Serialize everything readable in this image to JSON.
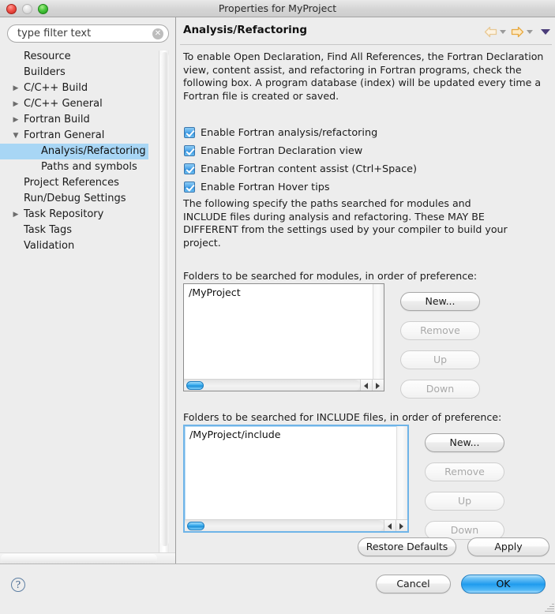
{
  "window": {
    "title": "Properties for MyProject",
    "traffic_lights": [
      "close-button",
      "minimize-button",
      "zoom-button"
    ]
  },
  "sidebar": {
    "filter": {
      "value": "",
      "placeholder": "type filter text",
      "clear_glyph": "✕"
    },
    "items": [
      {
        "label": "Resource",
        "level": 1,
        "twisty": "",
        "selected": false
      },
      {
        "label": "Builders",
        "level": 1,
        "twisty": "",
        "selected": false
      },
      {
        "label": "C/C++ Build",
        "level": 1,
        "twisty": "▶",
        "selected": false
      },
      {
        "label": "C/C++ General",
        "level": 1,
        "twisty": "▶",
        "selected": false
      },
      {
        "label": "Fortran Build",
        "level": 1,
        "twisty": "▶",
        "selected": false
      },
      {
        "label": "Fortran General",
        "level": 1,
        "twisty": "▼",
        "selected": false
      },
      {
        "label": "Analysis/Refactoring",
        "level": 2,
        "twisty": "",
        "selected": true
      },
      {
        "label": "Paths and symbols",
        "level": 2,
        "twisty": "",
        "selected": false
      },
      {
        "label": "Project References",
        "level": 1,
        "twisty": "",
        "selected": false
      },
      {
        "label": "Run/Debug Settings",
        "level": 1,
        "twisty": "",
        "selected": false
      },
      {
        "label": "Task Repository",
        "level": 1,
        "twisty": "▶",
        "selected": false
      },
      {
        "label": "Task Tags",
        "level": 1,
        "twisty": "",
        "selected": false
      },
      {
        "label": "Validation",
        "level": 1,
        "twisty": "",
        "selected": false
      }
    ]
  },
  "page": {
    "title": "Analysis/Refactoring",
    "nav": {
      "back_icon": "back-arrow-icon",
      "forward_icon": "forward-arrow-icon",
      "menu_icon": "view-menu-icon"
    },
    "intro_text": "To enable Open Declaration, Find All References, the Fortran Declaration view, content assist, and refactoring in Fortran programs, check the following box.  A program database (index) will be updated every time a Fortran file is created or saved.",
    "checkboxes": [
      {
        "label": "Enable Fortran analysis/refactoring",
        "checked": true
      },
      {
        "label": "Enable Fortran Declaration view",
        "checked": true
      },
      {
        "label": "Enable Fortran content assist (Ctrl+Space)",
        "checked": true
      },
      {
        "label": "Enable Fortran Hover tips",
        "checked": true
      }
    ],
    "paths_text": "The following specify the paths searched for modules and INCLUDE files during analysis and refactoring. These MAY BE DIFFERENT from the settings used by your compiler to build your project.",
    "modules_section": {
      "label": "Folders to be searched for modules, in order of preference:",
      "entries": [
        "/MyProject"
      ],
      "buttons": [
        {
          "label": "New...",
          "disabled": false
        },
        {
          "label": "Remove",
          "disabled": true
        },
        {
          "label": "Up",
          "disabled": true
        },
        {
          "label": "Down",
          "disabled": true
        }
      ]
    },
    "include_section": {
      "label": "Folders to be searched for INCLUDE files, in order of preference:",
      "entries": [
        "/MyProject/include"
      ],
      "buttons": [
        {
          "label": "New...",
          "disabled": false
        },
        {
          "label": "Remove",
          "disabled": true
        },
        {
          "label": "Up",
          "disabled": true
        },
        {
          "label": "Down",
          "disabled": true
        }
      ]
    },
    "restore_defaults_label": "Restore Defaults",
    "apply_label": "Apply"
  },
  "footer": {
    "help_glyph": "?",
    "cancel_label": "Cancel",
    "ok_label": "OK"
  },
  "colors": {
    "selection_blue": "#a8d6f5",
    "default_button_blue": "#1f9bee",
    "checkbox_blue": "#4da4e8",
    "forward_arrow_orange": "#f0b860",
    "back_arrow_tan": "#efd9b4",
    "window_bg": "#ededed"
  }
}
